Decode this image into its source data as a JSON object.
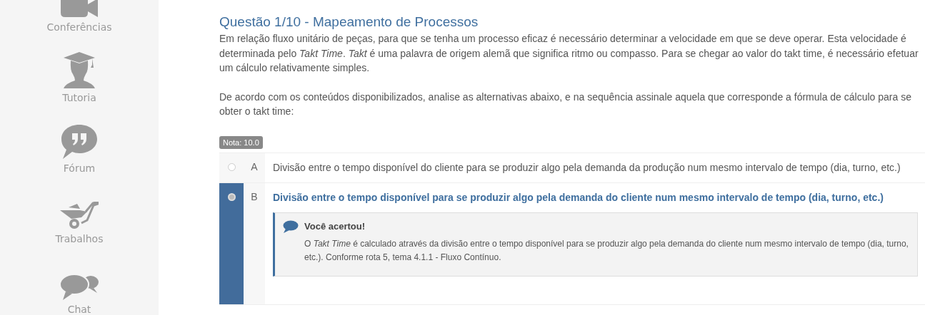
{
  "sidebar": {
    "items": [
      {
        "label": "Conferências"
      },
      {
        "label": "Tutoria"
      },
      {
        "label": "Fórum"
      },
      {
        "label": "Trabalhos"
      },
      {
        "label": "Chat"
      }
    ]
  },
  "question": {
    "title": "Questão 1/10 - Mapeamento de Processos",
    "paragraphs": [
      "Em relação fluxo unitário de peças, para que se tenha um processo eficaz é necessário determinar a velocidade em que se deve operar. Esta velocidade é determinada pelo *Takt Time*. *Takt* é uma palavra de origem alemã que significa ritmo ou compasso. Para se chegar ao valor do takt time, é necessário efetuar um cálculo relativamente simples.",
      "De acordo com os conteúdos disponibilizados, analise as alternativas abaixo, e na sequência assinale aquela que corresponde a fórmula de cálculo para se obter o takt time:"
    ],
    "grade": "Nota: 10.0",
    "options": [
      {
        "letter": "A",
        "text": "Divisão entre o tempo disponível do cliente para se produzir algo pela demanda da produção num mesmo intervalo de tempo (dia, turno, etc.)",
        "selected": false
      },
      {
        "letter": "B",
        "text": "Divisão entre o tempo disponível para se produzir algo pela demanda do cliente num mesmo intervalo de tempo (dia, turno, etc.)",
        "selected": true,
        "feedback": {
          "title": "Você acertou!",
          "text": "O *Takt Time* é calculado através da divisão entre o tempo disponível para se produzir algo pela demanda do cliente num mesmo intervalo de tempo (dia, turno, etc.). Conforme rota 5, tema 4.1.1 - Fluxo Contínuo."
        }
      }
    ]
  }
}
